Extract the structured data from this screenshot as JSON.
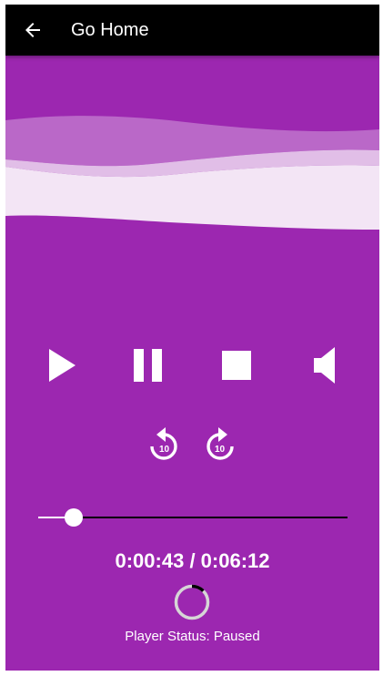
{
  "app_bar": {
    "title": "Go Home",
    "back_icon": "arrow-back-icon"
  },
  "colors": {
    "background": "#9c27b0",
    "app_bar": "#000000",
    "wave_light": "#ba68c8",
    "wave_lighter": "#e1bee7",
    "wave_lightest": "#f3e5f5"
  },
  "controls": {
    "play_icon": "play-icon",
    "pause_icon": "pause-icon",
    "stop_icon": "stop-icon",
    "volume_icon": "volume-icon",
    "replay_icon": "replay-10-icon",
    "forward_icon": "forward-10-icon",
    "replay_seconds": "10",
    "forward_seconds": "10"
  },
  "progress": {
    "position": "0:00:43",
    "duration": "0:06:12",
    "separator": " / ",
    "fraction": 0.115
  },
  "status": {
    "label": "Player Status: ",
    "value": "Paused"
  }
}
